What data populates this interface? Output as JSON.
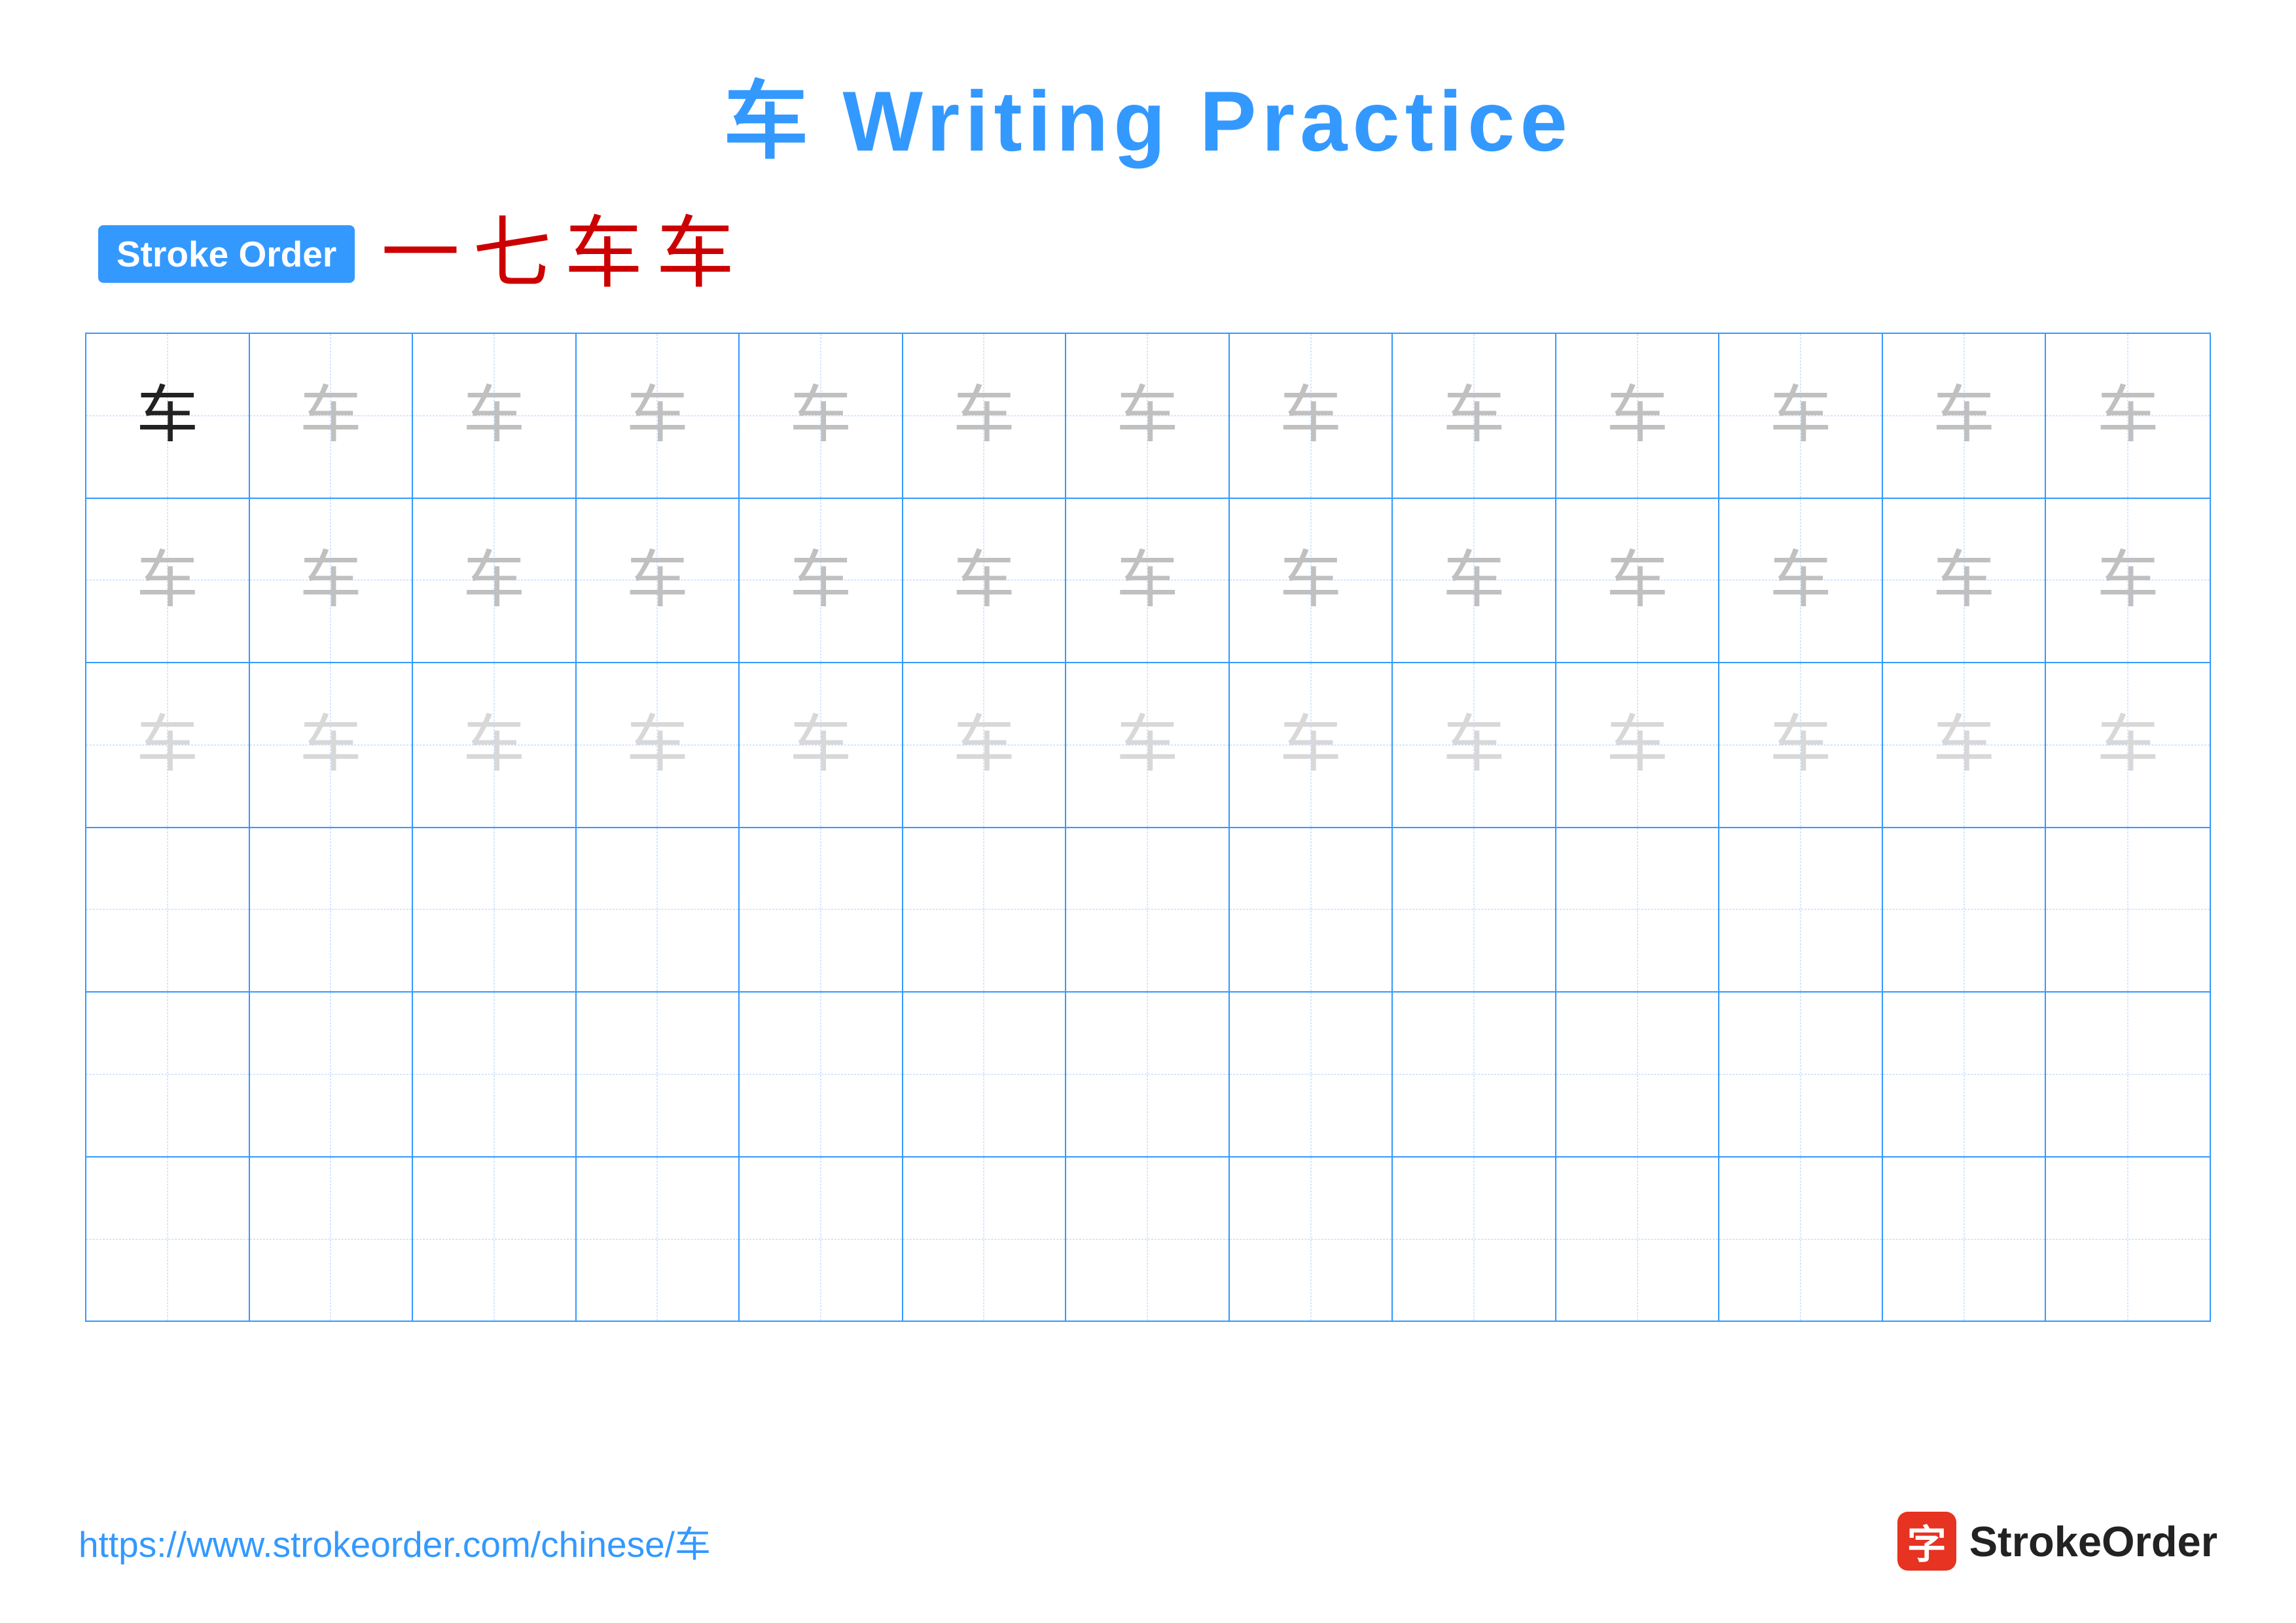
{
  "title": {
    "char": "车",
    "text": " Writing Practice"
  },
  "stroke_order": {
    "badge_label": "Stroke Order",
    "strokes": [
      "一",
      "七",
      "车",
      "车"
    ]
  },
  "grid": {
    "rows": 6,
    "cols": 13,
    "char": "车",
    "row_styles": [
      [
        "dark",
        "medium",
        "medium",
        "medium",
        "medium",
        "medium",
        "medium",
        "medium",
        "medium",
        "medium",
        "medium",
        "medium",
        "medium"
      ],
      [
        "medium",
        "medium",
        "medium",
        "medium",
        "medium",
        "medium",
        "medium",
        "medium",
        "medium",
        "medium",
        "medium",
        "medium",
        "medium"
      ],
      [
        "light",
        "light",
        "light",
        "light",
        "light",
        "light",
        "light",
        "light",
        "light",
        "light",
        "light",
        "light",
        "light"
      ],
      [
        "empty",
        "empty",
        "empty",
        "empty",
        "empty",
        "empty",
        "empty",
        "empty",
        "empty",
        "empty",
        "empty",
        "empty",
        "empty"
      ],
      [
        "empty",
        "empty",
        "empty",
        "empty",
        "empty",
        "empty",
        "empty",
        "empty",
        "empty",
        "empty",
        "empty",
        "empty",
        "empty"
      ],
      [
        "empty",
        "empty",
        "empty",
        "empty",
        "empty",
        "empty",
        "empty",
        "empty",
        "empty",
        "empty",
        "empty",
        "empty",
        "empty"
      ]
    ]
  },
  "footer": {
    "url": "https://www.strokeorder.com/chinese/车",
    "logo_char": "字",
    "logo_text": "StrokeOrder"
  }
}
